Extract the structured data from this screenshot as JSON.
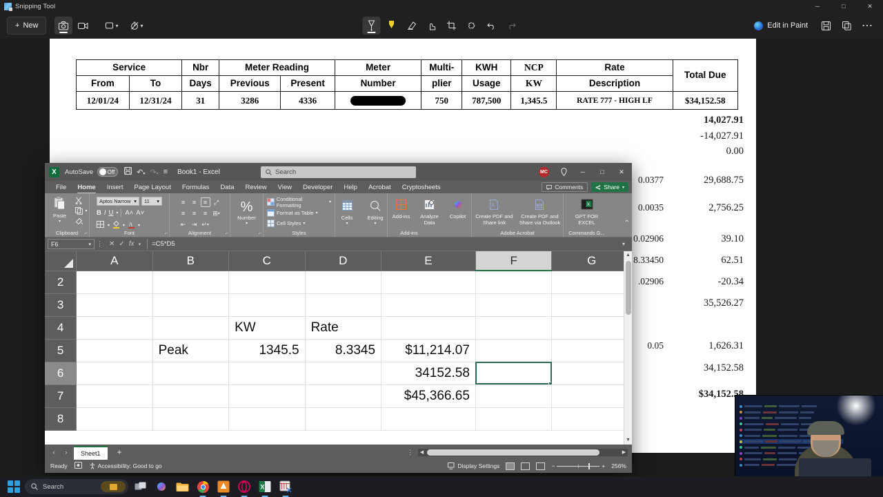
{
  "snipping_tool": {
    "title": "Snipping Tool",
    "new_button": "New",
    "mode_icons": [
      {
        "name": "screenshot-mode",
        "glyph": "▣"
      },
      {
        "name": "video-record-mode",
        "glyph": "▷"
      },
      {
        "name": "rectangle-shape",
        "glyph": "▭"
      },
      {
        "name": "delay-timer",
        "glyph": "⏱"
      }
    ],
    "tools": [
      {
        "name": "ballpoint-pen-icon",
        "glyph": "✐"
      },
      {
        "name": "highlighter-icon",
        "glyph": "✎"
      },
      {
        "name": "eraser-icon",
        "glyph": "◱"
      },
      {
        "name": "touch-writing-icon",
        "glyph": "☝"
      },
      {
        "name": "crop-icon",
        "glyph": "⋆"
      },
      {
        "name": "shapes-icon",
        "glyph": "⬟"
      },
      {
        "name": "undo-icon",
        "glyph": "↶"
      },
      {
        "name": "redo-icon",
        "glyph": "↷"
      }
    ],
    "edit_in_paint": "Edit in Paint",
    "save_icon": "ὋE",
    "copy_icon": "⧉",
    "more_icon": "⋯",
    "window_buttons": {
      "minimize": "─",
      "maximize": "□",
      "close": "✕"
    }
  },
  "document": {
    "table": {
      "header_row_1": [
        "Service",
        "Nbr",
        "Meter Reading",
        "Meter",
        "Multi-",
        "KWH",
        "NCP",
        "Rate",
        "Total Due"
      ],
      "headers": [
        {
          "top": "Service",
          "sub": [
            "From",
            "To"
          ]
        },
        {
          "top": "Nbr",
          "sub": [
            "Days"
          ]
        },
        {
          "top": "Meter Reading",
          "sub": [
            "Previous",
            "Present"
          ]
        },
        {
          "top": "Meter",
          "sub": [
            "Number"
          ]
        },
        {
          "top": "Multi-",
          "sub": [
            "plier"
          ]
        },
        {
          "top": "KWH",
          "sub": [
            "Usage"
          ]
        },
        {
          "top": "NCP",
          "sub": [
            "KW"
          ]
        },
        {
          "top": "Rate",
          "sub": [
            "Description"
          ]
        },
        {
          "top": "Total Due",
          "sub": [
            ""
          ]
        }
      ],
      "row": {
        "service_from": "12/01/24",
        "service_to": "12/31/24",
        "nbr_days": "31",
        "meter_previous": "3286",
        "meter_present": "4336",
        "meter_number": "",
        "multiplier": "750",
        "kwh_usage": "787,500",
        "ncp_kw": "1,345.5",
        "rate_description": "RATE 777 - HIGH LF",
        "total_due": "$34,152.58"
      }
    },
    "right_column": [
      {
        "rate": "",
        "amount": "14,027.91",
        "bold": true
      },
      {
        "rate": "",
        "amount": "-14,027.91",
        "bold": false
      },
      {
        "rate": "",
        "amount": "0.00",
        "bold": false
      },
      {
        "rate": "0.0377",
        "amount": "29,688.75",
        "bold": false
      },
      {
        "rate": "0.0035",
        "amount": "2,756.25",
        "bold": false
      },
      {
        "rate": "0.02906",
        "amount": "39.10",
        "bold": false
      },
      {
        "rate": "8.33450",
        "amount": "62.51",
        "bold": false
      },
      {
        "rate": ".02906",
        "amount": "-20.34",
        "bold": false
      },
      {
        "rate": "",
        "amount": "35,526.27",
        "bold": false
      },
      {
        "rate": "0.05",
        "amount": "1,626.31",
        "bold": false
      },
      {
        "rate": "",
        "amount": "34,152.58",
        "bold": false
      },
      {
        "rate": "",
        "amount": "$34,152.58",
        "bold": true
      }
    ]
  },
  "excel": {
    "titlebar": {
      "app_icon_letter": "X",
      "autosave_label": "AutoSave",
      "autosave_state": "Off",
      "save_icon": "὚B",
      "undo_icon": "↶",
      "redo_icon": "↷",
      "customize_icon": "≡",
      "document_name": "Book1  -  Excel",
      "search_placeholder": "Search",
      "search_value": "",
      "account_initials": "MC",
      "help_icon": "☉",
      "minimize": "─",
      "restore": "□",
      "close": "✕"
    },
    "ribbon_tabs": [
      "File",
      "Home",
      "Insert",
      "Page Layout",
      "Formulas",
      "Data",
      "Review",
      "View",
      "Developer",
      "Help",
      "Acrobat",
      "Cryptosheets"
    ],
    "active_tab": "Home",
    "comments_label": "Comments",
    "share_label": "Share",
    "ribbon_groups": [
      {
        "name": "Clipboard",
        "label": "Clipboard",
        "buttons": [
          {
            "label": "Paste",
            "icon": "ὌB"
          },
          {
            "label": "Cut",
            "icon": "✂"
          },
          {
            "label": "Copy",
            "icon": "⧉"
          },
          {
            "label": "Format Painter",
            "icon": "὘C"
          }
        ]
      },
      {
        "name": "Font",
        "label": "Font",
        "font_name": "Aptos Narrow",
        "font_size": "11",
        "buttons": [
          "B",
          "I",
          "U",
          "A↑",
          "A↓",
          "Borders",
          "Fill Color",
          "Font Color"
        ]
      },
      {
        "name": "Alignment",
        "label": "Alignment",
        "buttons": [
          "Top Align",
          "Middle Align",
          "Bottom Align",
          "Orientation",
          "Align Left",
          "Center",
          "Align Right",
          "Merge & Center",
          "Decrease Indent",
          "Increase Indent",
          "Wrap Text"
        ]
      },
      {
        "name": "Number",
        "label": "Number",
        "buttons": [
          {
            "label": "Number",
            "icon": "%"
          }
        ]
      },
      {
        "name": "Styles",
        "label": "Styles",
        "buttons": [
          {
            "label": "Conditional Formatting"
          },
          {
            "label": "Format as Table"
          },
          {
            "label": "Cell Styles"
          }
        ]
      },
      {
        "name": "Cells",
        "label": "",
        "buttons": [
          {
            "label": "Cells"
          },
          {
            "label": "Editing"
          }
        ]
      },
      {
        "name": "Add-ins",
        "label": "Add-ins",
        "buttons": [
          {
            "label": "Add-ins"
          },
          {
            "label": "Analyze Data"
          },
          {
            "label": "Copilot"
          }
        ]
      },
      {
        "name": "Adobe Acrobat",
        "label": "Adobe Acrobat",
        "buttons": [
          {
            "label": "Create PDF and Share link"
          },
          {
            "label": "Create PDF and Share via Outlook"
          }
        ]
      },
      {
        "name": "Commands Group",
        "label": "Commands G...",
        "buttons": [
          {
            "label": "GPT FOR EXCEL"
          }
        ]
      }
    ],
    "formula_bar": {
      "name_box": "F6",
      "cancel_icon": "✕",
      "enter_icon": "✓",
      "function_icon": "fx",
      "formula": "=C5*D5"
    },
    "grid": {
      "columns": [
        "A",
        "B",
        "C",
        "D",
        "E",
        "F",
        "G"
      ],
      "selected_column": "F",
      "rows": [
        "2",
        "3",
        "4",
        "5",
        "6",
        "7",
        "8"
      ],
      "selected_row": "6",
      "active_cell": "F6",
      "cells": [
        {
          "row": "2",
          "A": "",
          "B": "",
          "C": "",
          "D": "",
          "E": "",
          "F": "",
          "G": ""
        },
        {
          "row": "3",
          "A": "",
          "B": "",
          "C": "",
          "D": "",
          "E": "",
          "F": "",
          "G": ""
        },
        {
          "row": "4",
          "A": "",
          "B": "",
          "C": "KW",
          "D": "Rate",
          "E": "",
          "F": "",
          "G": ""
        },
        {
          "row": "5",
          "A": "",
          "B": "Peak",
          "C": "1345.5",
          "D": "8.3345",
          "E": "$11,214.07",
          "F": "",
          "G": ""
        },
        {
          "row": "6",
          "A": "",
          "B": "",
          "C": "",
          "D": "",
          "E": "34152.58",
          "F": "",
          "G": ""
        },
        {
          "row": "7",
          "A": "",
          "B": "",
          "C": "",
          "D": "",
          "E": "$45,366.65",
          "F": "",
          "G": ""
        },
        {
          "row": "8",
          "A": "",
          "B": "",
          "C": "",
          "D": "",
          "E": "",
          "F": "",
          "G": ""
        }
      ]
    },
    "sheet_bar": {
      "prev_icon": "‹",
      "next_icon": "›",
      "sheets": [
        "Sheet1"
      ],
      "active_sheet": "Sheet1",
      "add_sheet": "+"
    },
    "status_bar": {
      "mode": "Ready",
      "macro_icon": "▣",
      "accessibility": "Accessibility: Good to go",
      "display_settings": "Display Settings",
      "view_normal": "normal-view",
      "view_page_layout": "page-layout-view",
      "view_page_break": "page-break-view",
      "zoom_out": "−",
      "zoom_in": "+",
      "zoom_level": "256%"
    }
  },
  "taskbar": {
    "start_label": "start-button",
    "search_placeholder": "Search",
    "items": [
      {
        "name": "task-view",
        "glyph": "▣"
      },
      {
        "name": "copilot",
        "glyph": "◆"
      },
      {
        "name": "file-explorer",
        "glyph": "Ὄ1"
      },
      {
        "name": "google-chrome",
        "glyph": "◉"
      },
      {
        "name": "drawio",
        "glyph": "▲"
      },
      {
        "name": "opera",
        "glyph": "○"
      },
      {
        "name": "microsoft-excel",
        "glyph": "X"
      },
      {
        "name": "snipping-tool",
        "glyph": "✂"
      }
    ]
  }
}
